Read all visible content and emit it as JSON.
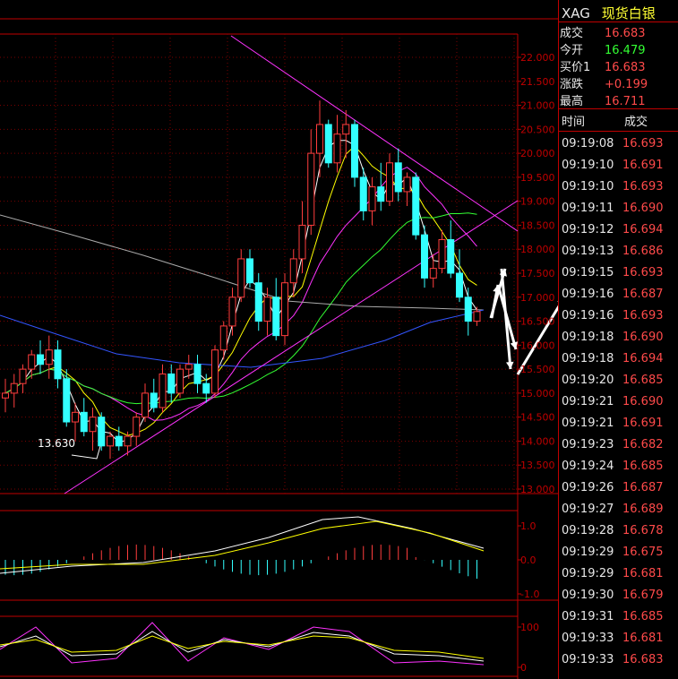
{
  "symbol": {
    "code": "XAG",
    "name": "现货白银"
  },
  "quote": [
    {
      "label": "成交",
      "value": "16.683",
      "color": "#ff4a4a"
    },
    {
      "label": "今开",
      "value": "16.479",
      "color": "#33ff33"
    },
    {
      "label": "买价1",
      "value": "16.683",
      "color": "#ff4a4a"
    },
    {
      "label": "涨跌",
      "value": "+0.199",
      "color": "#ff4a4a"
    },
    {
      "label": "最高",
      "value": "16.711",
      "color": "#ff4a4a"
    }
  ],
  "ticks_header": {
    "time": "时间",
    "price": "成交"
  },
  "ticks": [
    {
      "time": "09:19:08",
      "price": "16.693"
    },
    {
      "time": "09:19:10",
      "price": "16.691"
    },
    {
      "time": "09:19:10",
      "price": "16.693"
    },
    {
      "time": "09:19:11",
      "price": "16.690"
    },
    {
      "time": "09:19:12",
      "price": "16.694"
    },
    {
      "time": "09:19:13",
      "price": "16.686"
    },
    {
      "time": "09:19:15",
      "price": "16.693"
    },
    {
      "time": "09:19:16",
      "price": "16.687"
    },
    {
      "time": "09:19:16",
      "price": "16.693"
    },
    {
      "time": "09:19:18",
      "price": "16.690"
    },
    {
      "time": "09:19:18",
      "price": "16.694"
    },
    {
      "time": "09:19:20",
      "price": "16.685"
    },
    {
      "time": "09:19:21",
      "price": "16.690"
    },
    {
      "time": "09:19:21",
      "price": "16.691"
    },
    {
      "time": "09:19:23",
      "price": "16.682"
    },
    {
      "time": "09:19:24",
      "price": "16.685"
    },
    {
      "time": "09:19:26",
      "price": "16.687"
    },
    {
      "time": "09:19:27",
      "price": "16.689"
    },
    {
      "time": "09:19:28",
      "price": "16.678"
    },
    {
      "time": "09:19:29",
      "price": "16.675"
    },
    {
      "time": "09:19:29",
      "price": "16.681"
    },
    {
      "time": "09:19:30",
      "price": "16.679"
    },
    {
      "time": "09:19:31",
      "price": "16.685"
    },
    {
      "time": "09:19:33",
      "price": "16.681"
    },
    {
      "time": "09:19:33",
      "price": "16.683"
    }
  ],
  "chart_data": [
    {
      "type": "candlestick",
      "title": "",
      "y_ticks": [
        "22.000",
        "21.500",
        "21.000",
        "20.500",
        "20.000",
        "19.500",
        "19.000",
        "18.500",
        "18.000",
        "17.500",
        "17.000",
        "16.500",
        "16.000",
        "15.500",
        "15.000",
        "14.500",
        "14.000",
        "13.500",
        "13.000"
      ],
      "ylim": [
        13.0,
        22.0
      ],
      "annotation_low": "13.630",
      "candles": [
        [
          14.9,
          15.3,
          14.6,
          15.0
        ],
        [
          15.0,
          15.4,
          14.7,
          15.2
        ],
        [
          15.2,
          15.6,
          15.0,
          15.5
        ],
        [
          15.5,
          15.9,
          15.3,
          15.8
        ],
        [
          15.8,
          16.1,
          15.4,
          15.6
        ],
        [
          15.6,
          16.2,
          15.3,
          15.9
        ],
        [
          15.9,
          16.1,
          15.1,
          15.3
        ],
        [
          15.3,
          15.5,
          14.3,
          14.4
        ],
        [
          14.4,
          14.8,
          14.0,
          14.6
        ],
        [
          14.6,
          14.9,
          14.1,
          14.2
        ],
        [
          14.2,
          14.7,
          13.8,
          14.5
        ],
        [
          14.5,
          14.6,
          13.8,
          13.9
        ],
        [
          13.9,
          14.2,
          13.63,
          14.1
        ],
        [
          14.1,
          14.3,
          13.8,
          13.9
        ],
        [
          13.9,
          14.2,
          13.7,
          14.1
        ],
        [
          14.1,
          14.6,
          13.9,
          14.5
        ],
        [
          14.5,
          15.2,
          14.4,
          15.0
        ],
        [
          15.0,
          15.3,
          14.6,
          14.7
        ],
        [
          14.7,
          15.6,
          14.6,
          15.4
        ],
        [
          15.4,
          15.6,
          14.8,
          15.0
        ],
        [
          15.0,
          15.6,
          14.9,
          15.5
        ],
        [
          15.5,
          15.8,
          15.3,
          15.6
        ],
        [
          15.6,
          15.8,
          15.0,
          15.2
        ],
        [
          15.2,
          15.4,
          14.8,
          15.0
        ],
        [
          15.0,
          16.0,
          14.9,
          15.9
        ],
        [
          15.9,
          16.5,
          15.7,
          16.4
        ],
        [
          16.4,
          17.2,
          16.2,
          17.0
        ],
        [
          17.0,
          18.0,
          16.9,
          17.8
        ],
        [
          17.8,
          18.0,
          17.2,
          17.3
        ],
        [
          17.3,
          17.5,
          16.3,
          16.5
        ],
        [
          16.5,
          17.2,
          16.2,
          17.0
        ],
        [
          17.0,
          17.4,
          16.1,
          16.2
        ],
        [
          16.2,
          17.5,
          16.0,
          17.3
        ],
        [
          17.3,
          18.0,
          17.0,
          17.8
        ],
        [
          17.8,
          19.0,
          17.5,
          18.5
        ],
        [
          18.5,
          20.5,
          18.3,
          20.0
        ],
        [
          20.0,
          21.1,
          19.5,
          20.6
        ],
        [
          20.6,
          20.7,
          19.7,
          19.8
        ],
        [
          19.8,
          20.8,
          19.6,
          20.4
        ],
        [
          20.4,
          20.9,
          19.9,
          20.6
        ],
        [
          20.6,
          20.7,
          19.3,
          19.5
        ],
        [
          19.5,
          19.7,
          18.6,
          18.8
        ],
        [
          18.8,
          19.5,
          18.5,
          19.3
        ],
        [
          19.3,
          19.8,
          18.8,
          19.0
        ],
        [
          19.0,
          20.0,
          18.9,
          19.8
        ],
        [
          19.8,
          20.1,
          19.0,
          19.2
        ],
        [
          19.2,
          19.6,
          18.9,
          19.5
        ],
        [
          19.5,
          19.6,
          18.2,
          18.3
        ],
        [
          18.3,
          18.5,
          17.2,
          17.4
        ],
        [
          17.4,
          17.9,
          17.2,
          17.6
        ],
        [
          17.6,
          18.4,
          17.5,
          18.2
        ],
        [
          18.2,
          18.6,
          17.4,
          17.5
        ],
        [
          17.5,
          18.0,
          16.9,
          17.0
        ],
        [
          17.0,
          17.2,
          16.2,
          16.5
        ],
        [
          16.5,
          16.8,
          16.4,
          16.7
        ]
      ]
    },
    {
      "type": "bar",
      "title": "",
      "y_ticks": [
        "1.0",
        "0.0",
        "-1.0"
      ],
      "ylim": [
        -1.0,
        1.0
      ]
    },
    {
      "type": "line",
      "title": "",
      "y_ticks": [
        "100",
        "0"
      ],
      "ylim": [
        0,
        100
      ]
    }
  ],
  "colors": {
    "up": "#ff3d3d",
    "down": "#33ffff",
    "grid": "#7a0000",
    "axis": "#c00000"
  }
}
